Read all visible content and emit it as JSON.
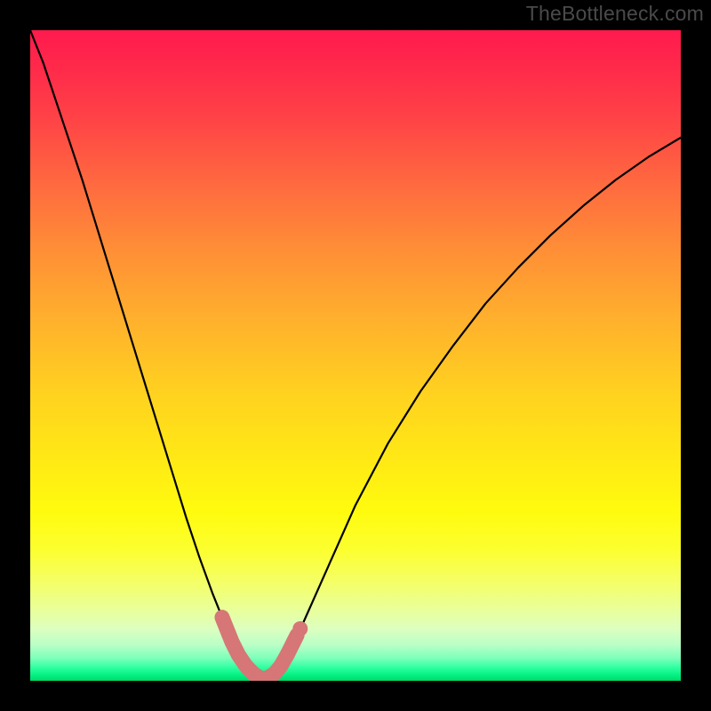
{
  "watermark": "TheBottleneck.com",
  "chart_data": {
    "type": "line",
    "title": "",
    "xlabel": "",
    "ylabel": "",
    "xlim": [
      0,
      1
    ],
    "ylim": [
      0,
      100
    ],
    "background": "gradient-bottleneck",
    "x": [
      0.0,
      0.02,
      0.04,
      0.06,
      0.08,
      0.1,
      0.12,
      0.14,
      0.16,
      0.18,
      0.2,
      0.22,
      0.24,
      0.26,
      0.28,
      0.3,
      0.31,
      0.32,
      0.33,
      0.34,
      0.35,
      0.355,
      0.36,
      0.37,
      0.38,
      0.39,
      0.4,
      0.42,
      0.44,
      0.46,
      0.48,
      0.5,
      0.55,
      0.6,
      0.65,
      0.7,
      0.75,
      0.8,
      0.85,
      0.9,
      0.95,
      1.0
    ],
    "series": [
      {
        "name": "bottleneck-curve",
        "values": [
          100,
          95,
          89,
          83,
          77,
          70.5,
          64,
          57.5,
          51,
          44.5,
          38,
          31.5,
          25,
          19,
          13.5,
          8.5,
          6,
          4,
          2.5,
          1.3,
          0.6,
          0.3,
          0.3,
          0.6,
          1.5,
          3,
          5,
          9,
          13.5,
          18,
          22.5,
          27,
          36.5,
          44.5,
          51.5,
          58,
          63.5,
          68.5,
          73,
          77,
          80.5,
          83.5
        ]
      }
    ],
    "markers": {
      "color": "#d67676",
      "segments_x": [
        [
          0.295,
          0.305
        ],
        [
          0.305,
          0.335
        ],
        [
          0.335,
          0.395
        ],
        [
          0.395,
          0.41
        ]
      ],
      "dot_x": 0.415
    },
    "gradient_stops": [
      {
        "pct": 0,
        "color": "#ff1a4e"
      },
      {
        "pct": 50,
        "color": "#ffd21f"
      },
      {
        "pct": 80,
        "color": "#fcff30"
      },
      {
        "pct": 100,
        "color": "#00d868"
      }
    ]
  }
}
